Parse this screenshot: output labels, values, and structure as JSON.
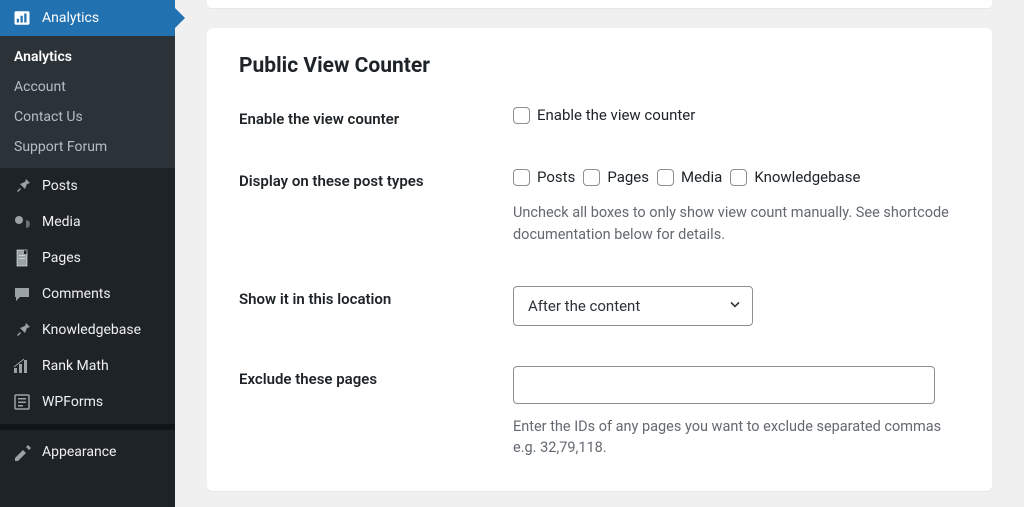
{
  "sidebar": {
    "current": {
      "label": "Analytics"
    },
    "submenu": [
      {
        "label": "Analytics",
        "active": true
      },
      {
        "label": "Account"
      },
      {
        "label": "Contact Us"
      },
      {
        "label": "Support Forum"
      }
    ],
    "items": [
      {
        "label": "Posts"
      },
      {
        "label": "Media"
      },
      {
        "label": "Pages"
      },
      {
        "label": "Comments"
      },
      {
        "label": "Knowledgebase"
      },
      {
        "label": "Rank Math"
      },
      {
        "label": "WPForms"
      },
      {
        "label": "Appearance"
      }
    ]
  },
  "settings": {
    "title": "Public View Counter",
    "enable": {
      "label": "Enable the view counter",
      "checkbox_label": "Enable the view counter"
    },
    "post_types": {
      "label": "Display on these post types",
      "options": [
        "Posts",
        "Pages",
        "Media",
        "Knowledgebase"
      ],
      "help": "Uncheck all boxes to only show view count manually. See shortcode documentation below for details."
    },
    "location": {
      "label": "Show it in this location",
      "value": "After the content"
    },
    "exclude": {
      "label": "Exclude these pages",
      "value": "",
      "help": "Enter the IDs of any pages you want to exclude separated commas e.g. 32,79,118."
    }
  }
}
